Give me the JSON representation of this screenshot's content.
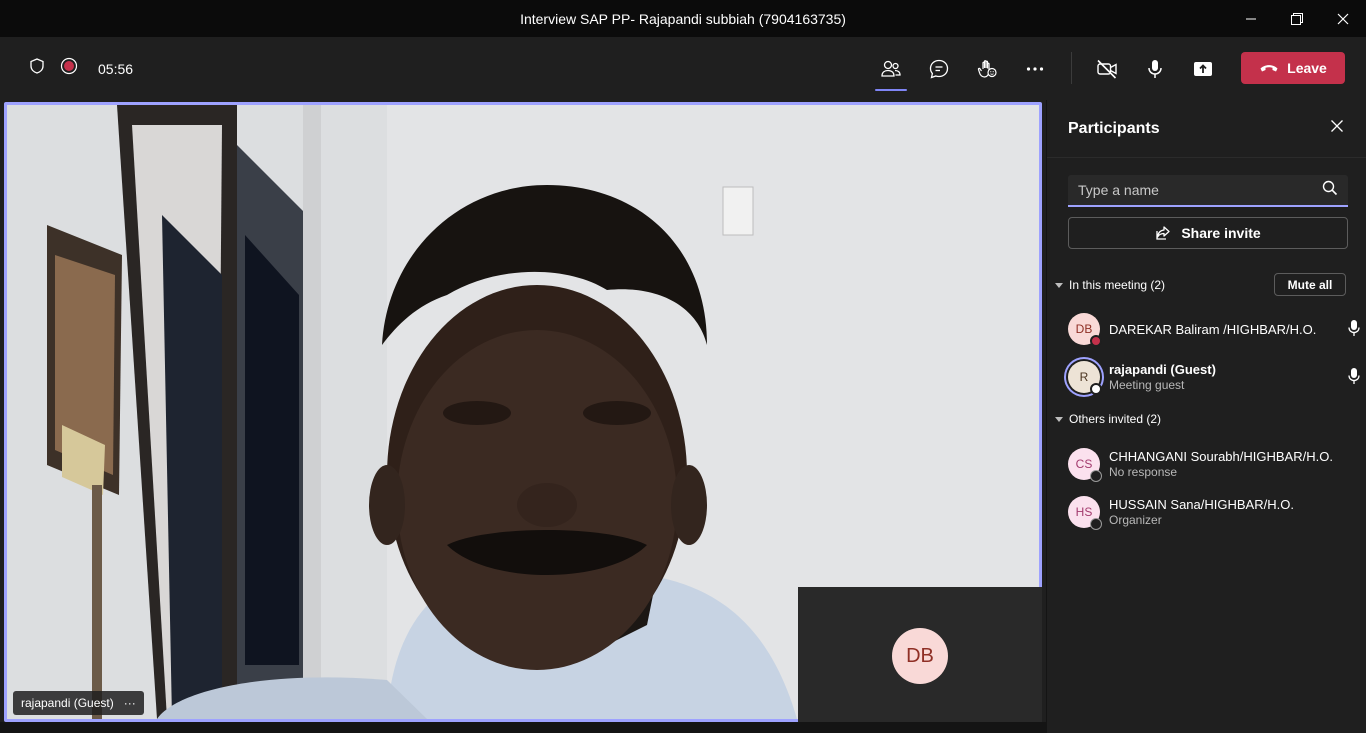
{
  "window": {
    "title": "Interview SAP PP- Rajapandi subbiah (7904163735)",
    "controls": [
      "minimize-icon",
      "restore-icon",
      "close-icon"
    ]
  },
  "toolbar": {
    "timer": "05:56",
    "left_icons": [
      "shield-icon",
      "record-icon"
    ],
    "buttons": [
      "participants-icon",
      "chat-icon",
      "raise-hand-icon",
      "more-icon",
      "camera-off-icon",
      "mic-icon",
      "share-screen-icon"
    ],
    "leave_label": "Leave",
    "leave_color": "#c4314b"
  },
  "stage": {
    "main_participant": "rajapandi (Guest)",
    "more_label": "···",
    "self_initials": "DB",
    "accent": "#9ea2ff"
  },
  "panel": {
    "title": "Participants",
    "search_placeholder": "Type a name",
    "share_invite_label": "Share invite",
    "in_meeting_label": "In this meeting (2)",
    "mute_all_label": "Mute all",
    "others_label": "Others invited (2)",
    "in_meeting": [
      {
        "initials": "DB",
        "name": "DAREKAR Baliram /HIGHBAR/H.O.",
        "sub": "",
        "status": "busy"
      },
      {
        "initials": "R",
        "name": "rajapandi (Guest)",
        "sub": "Meeting guest",
        "status": "available"
      }
    ],
    "others": [
      {
        "initials": "CS",
        "name": "CHHANGANI Sourabh/HIGHBAR/H.O.",
        "sub": "No response",
        "status": "unknown"
      },
      {
        "initials": "HS",
        "name": "HUSSAIN Sana/HIGHBAR/H.O.",
        "sub": "Organizer",
        "status": "unknown"
      }
    ]
  }
}
